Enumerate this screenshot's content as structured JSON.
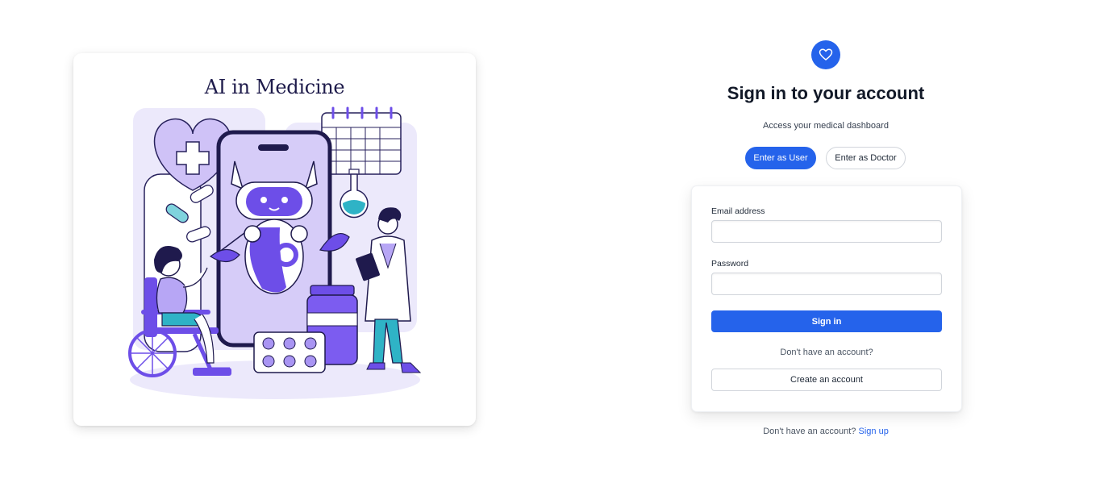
{
  "illustration": {
    "title": "AI in Medicine"
  },
  "header": {
    "logo_icon": "heart-icon",
    "title": "Sign in to your account",
    "subtitle": "Access your medical dashboard"
  },
  "roles": {
    "user_label": "Enter as User",
    "doctor_label": "Enter as Doctor",
    "selected": "user"
  },
  "form": {
    "email_label": "Email address",
    "email_value": "",
    "password_label": "Password",
    "password_value": "",
    "signin_label": "Sign in",
    "no_account_text": "Don't have an account?",
    "create_label": "Create an account"
  },
  "footer": {
    "text": "Don't have an account?",
    "link": "Sign up"
  },
  "colors": {
    "accent": "#2563eb",
    "illustration_purple": "#6d4ee8",
    "illustration_teal": "#2fb3c6"
  }
}
